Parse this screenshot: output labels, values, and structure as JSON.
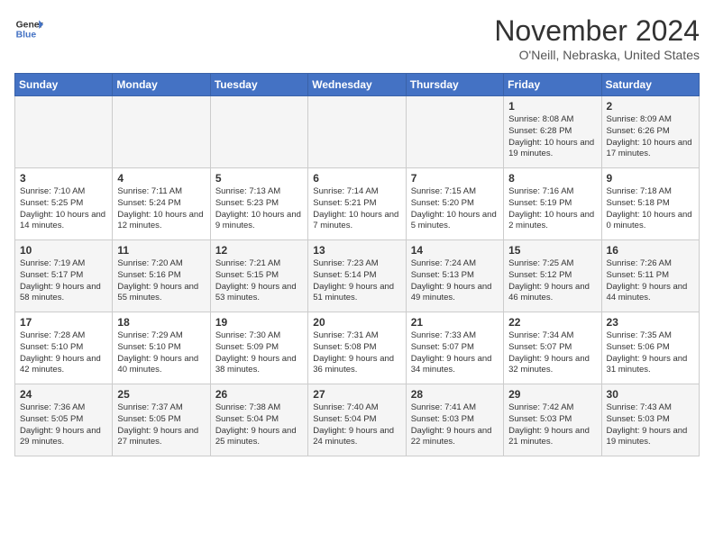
{
  "header": {
    "logo_line1": "General",
    "logo_line2": "Blue",
    "month": "November 2024",
    "location": "O'Neill, Nebraska, United States"
  },
  "days_of_week": [
    "Sunday",
    "Monday",
    "Tuesday",
    "Wednesday",
    "Thursday",
    "Friday",
    "Saturday"
  ],
  "weeks": [
    [
      {
        "day": "",
        "info": ""
      },
      {
        "day": "",
        "info": ""
      },
      {
        "day": "",
        "info": ""
      },
      {
        "day": "",
        "info": ""
      },
      {
        "day": "",
        "info": ""
      },
      {
        "day": "1",
        "info": "Sunrise: 8:08 AM\nSunset: 6:28 PM\nDaylight: 10 hours and 19 minutes."
      },
      {
        "day": "2",
        "info": "Sunrise: 8:09 AM\nSunset: 6:26 PM\nDaylight: 10 hours and 17 minutes."
      }
    ],
    [
      {
        "day": "3",
        "info": "Sunrise: 7:10 AM\nSunset: 5:25 PM\nDaylight: 10 hours and 14 minutes."
      },
      {
        "day": "4",
        "info": "Sunrise: 7:11 AM\nSunset: 5:24 PM\nDaylight: 10 hours and 12 minutes."
      },
      {
        "day": "5",
        "info": "Sunrise: 7:13 AM\nSunset: 5:23 PM\nDaylight: 10 hours and 9 minutes."
      },
      {
        "day": "6",
        "info": "Sunrise: 7:14 AM\nSunset: 5:21 PM\nDaylight: 10 hours and 7 minutes."
      },
      {
        "day": "7",
        "info": "Sunrise: 7:15 AM\nSunset: 5:20 PM\nDaylight: 10 hours and 5 minutes."
      },
      {
        "day": "8",
        "info": "Sunrise: 7:16 AM\nSunset: 5:19 PM\nDaylight: 10 hours and 2 minutes."
      },
      {
        "day": "9",
        "info": "Sunrise: 7:18 AM\nSunset: 5:18 PM\nDaylight: 10 hours and 0 minutes."
      }
    ],
    [
      {
        "day": "10",
        "info": "Sunrise: 7:19 AM\nSunset: 5:17 PM\nDaylight: 9 hours and 58 minutes."
      },
      {
        "day": "11",
        "info": "Sunrise: 7:20 AM\nSunset: 5:16 PM\nDaylight: 9 hours and 55 minutes."
      },
      {
        "day": "12",
        "info": "Sunrise: 7:21 AM\nSunset: 5:15 PM\nDaylight: 9 hours and 53 minutes."
      },
      {
        "day": "13",
        "info": "Sunrise: 7:23 AM\nSunset: 5:14 PM\nDaylight: 9 hours and 51 minutes."
      },
      {
        "day": "14",
        "info": "Sunrise: 7:24 AM\nSunset: 5:13 PM\nDaylight: 9 hours and 49 minutes."
      },
      {
        "day": "15",
        "info": "Sunrise: 7:25 AM\nSunset: 5:12 PM\nDaylight: 9 hours and 46 minutes."
      },
      {
        "day": "16",
        "info": "Sunrise: 7:26 AM\nSunset: 5:11 PM\nDaylight: 9 hours and 44 minutes."
      }
    ],
    [
      {
        "day": "17",
        "info": "Sunrise: 7:28 AM\nSunset: 5:10 PM\nDaylight: 9 hours and 42 minutes."
      },
      {
        "day": "18",
        "info": "Sunrise: 7:29 AM\nSunset: 5:10 PM\nDaylight: 9 hours and 40 minutes."
      },
      {
        "day": "19",
        "info": "Sunrise: 7:30 AM\nSunset: 5:09 PM\nDaylight: 9 hours and 38 minutes."
      },
      {
        "day": "20",
        "info": "Sunrise: 7:31 AM\nSunset: 5:08 PM\nDaylight: 9 hours and 36 minutes."
      },
      {
        "day": "21",
        "info": "Sunrise: 7:33 AM\nSunset: 5:07 PM\nDaylight: 9 hours and 34 minutes."
      },
      {
        "day": "22",
        "info": "Sunrise: 7:34 AM\nSunset: 5:07 PM\nDaylight: 9 hours and 32 minutes."
      },
      {
        "day": "23",
        "info": "Sunrise: 7:35 AM\nSunset: 5:06 PM\nDaylight: 9 hours and 31 minutes."
      }
    ],
    [
      {
        "day": "24",
        "info": "Sunrise: 7:36 AM\nSunset: 5:05 PM\nDaylight: 9 hours and 29 minutes."
      },
      {
        "day": "25",
        "info": "Sunrise: 7:37 AM\nSunset: 5:05 PM\nDaylight: 9 hours and 27 minutes."
      },
      {
        "day": "26",
        "info": "Sunrise: 7:38 AM\nSunset: 5:04 PM\nDaylight: 9 hours and 25 minutes."
      },
      {
        "day": "27",
        "info": "Sunrise: 7:40 AM\nSunset: 5:04 PM\nDaylight: 9 hours and 24 minutes."
      },
      {
        "day": "28",
        "info": "Sunrise: 7:41 AM\nSunset: 5:03 PM\nDaylight: 9 hours and 22 minutes."
      },
      {
        "day": "29",
        "info": "Sunrise: 7:42 AM\nSunset: 5:03 PM\nDaylight: 9 hours and 21 minutes."
      },
      {
        "day": "30",
        "info": "Sunrise: 7:43 AM\nSunset: 5:03 PM\nDaylight: 9 hours and 19 minutes."
      }
    ]
  ]
}
